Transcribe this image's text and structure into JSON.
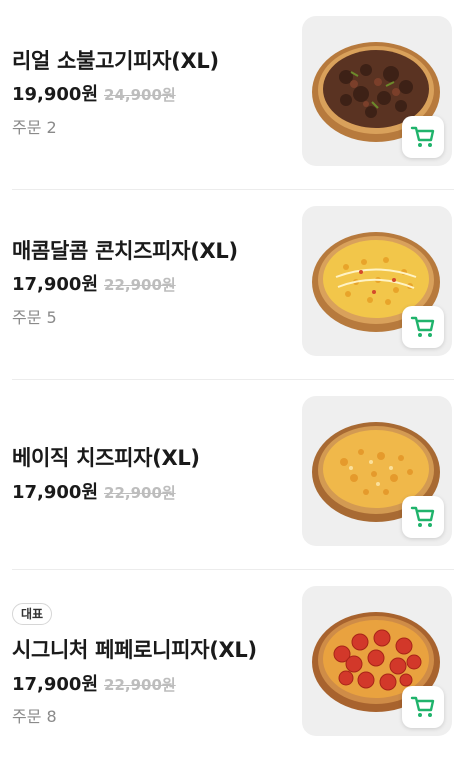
{
  "menu": [
    {
      "name": "리얼 소불고기피자(XL)",
      "price": "19,900원",
      "original_price": "24,900원",
      "orders": "주문 2",
      "badge": null,
      "topping": "bulgogi",
      "icon": "cart-icon"
    },
    {
      "name": "매콤달콤 콘치즈피자(XL)",
      "price": "17,900원",
      "original_price": "22,900원",
      "orders": "주문 5",
      "badge": null,
      "topping": "corn-cheese",
      "icon": "cart-icon"
    },
    {
      "name": "베이직 치즈피자(XL)",
      "price": "17,900원",
      "original_price": "22,900원",
      "orders": null,
      "badge": null,
      "topping": "cheese",
      "icon": "cart-icon"
    },
    {
      "name": "시그니처 페페로니피자(XL)",
      "price": "17,900원",
      "original_price": "22,900원",
      "orders": "주문 8",
      "badge": "대표",
      "topping": "pepperoni",
      "icon": "cart-icon"
    }
  ],
  "colors": {
    "cart_accent": "#1fb36b",
    "thumb_bg": "#efefef",
    "original_price": "#bdbdbd"
  }
}
